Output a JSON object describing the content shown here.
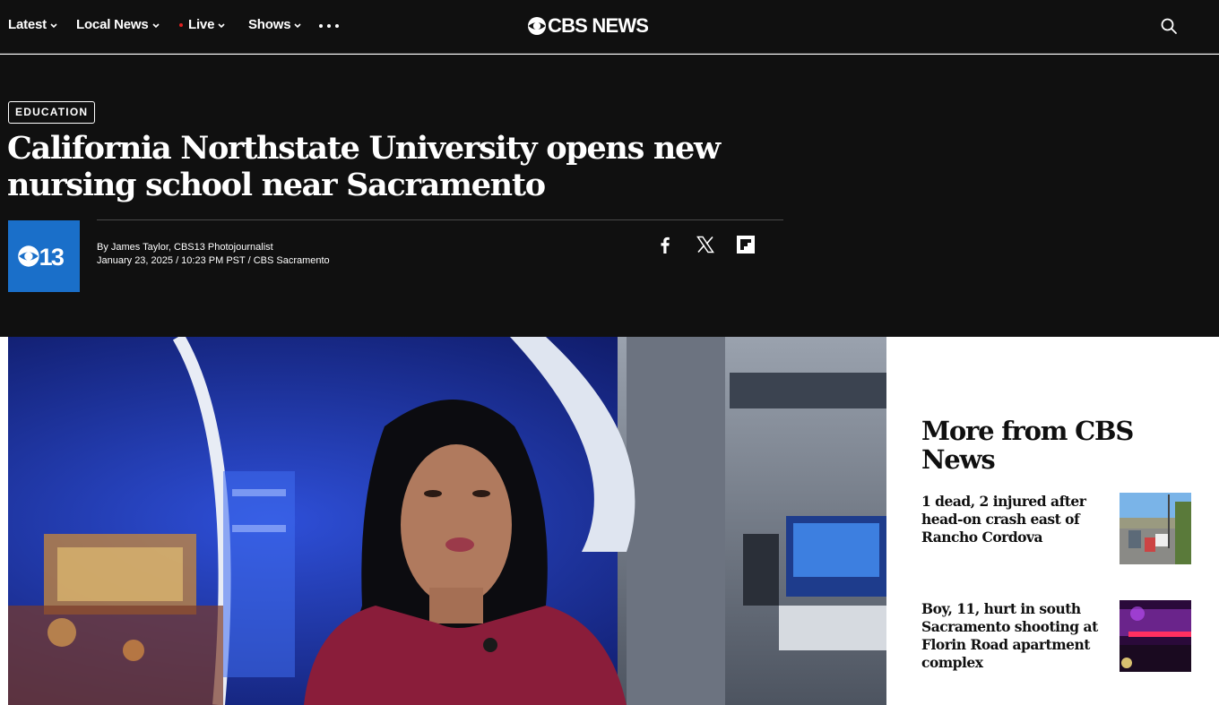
{
  "nav": {
    "items": [
      {
        "label": "Latest"
      },
      {
        "label": "Local News"
      },
      {
        "label": "Live"
      },
      {
        "label": "Shows"
      }
    ],
    "more_icon": "ellipsis-icon",
    "logo_text": "CBS NEWS",
    "search_icon": "search-icon"
  },
  "article": {
    "tag": "EDUCATION",
    "headline": "California Northstate University opens new nursing school near Sacramento",
    "station_logo_text": "13",
    "byline_prefix": "By ",
    "author": "James Taylor",
    "author_suffix": ", CBS13 Photojournalist",
    "date": "January 23, 2025 / 10:23 PM PST / ",
    "source": "CBS Sacramento",
    "share": [
      "facebook-icon",
      "x-icon",
      "flipboard-icon"
    ]
  },
  "sidebar": {
    "title": "More from CBS News",
    "stories": [
      {
        "title": "1 dead, 2 injured after head-on crash east of Rancho Cordova"
      },
      {
        "title": "Boy, 11, hurt in south Sacramento shooting at Florin Road apartment complex"
      }
    ]
  },
  "colors": {
    "header_bg": "#101010",
    "station_blue": "#1a6fc9",
    "live_dot": "#e0201f"
  }
}
